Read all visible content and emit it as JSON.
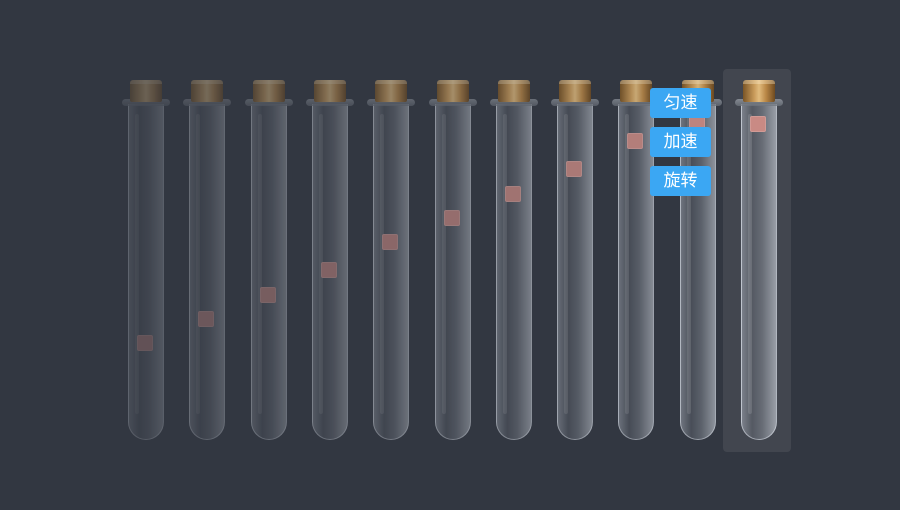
{
  "tubes": [
    {
      "id": "tube-1",
      "level": 0.63
    },
    {
      "id": "tube-2",
      "level": 0.56
    },
    {
      "id": "tube-3",
      "level": 0.49
    },
    {
      "id": "tube-4",
      "level": 0.42
    },
    {
      "id": "tube-5",
      "level": 0.34
    },
    {
      "id": "tube-6",
      "level": 0.27
    },
    {
      "id": "tube-7",
      "level": 0.2
    },
    {
      "id": "tube-8",
      "level": 0.13
    },
    {
      "id": "tube-9",
      "level": 0.05
    },
    {
      "id": "tube-10",
      "level": 0.0
    },
    {
      "id": "tube-11",
      "level": 0.0
    }
  ],
  "selected_tube": "tube-11",
  "context_menu": {
    "uniform_label": "匀速",
    "accelerate_label": "加速",
    "rotate_label": "旋转"
  },
  "colors": {
    "background": "#323741",
    "button": "#3ba7f3",
    "block": "#c98a84",
    "cap": "#c89a5a"
  }
}
